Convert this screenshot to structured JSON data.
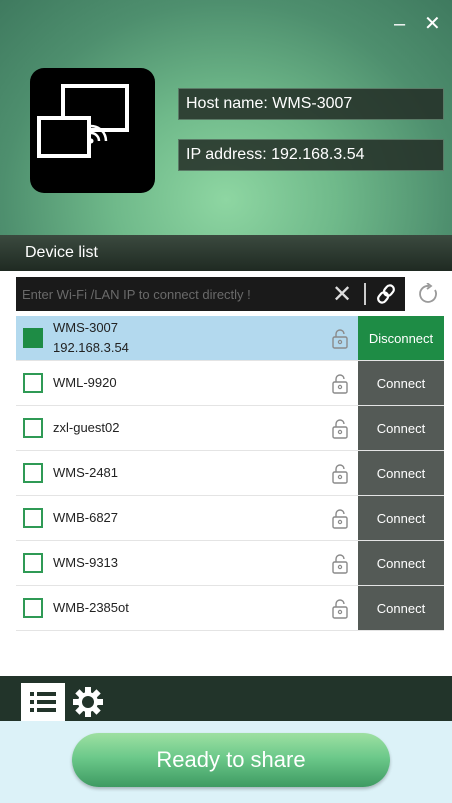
{
  "window": {
    "minimize_label": "–",
    "close_label": "✕"
  },
  "header": {
    "host_name": "Host name: WMS-3007",
    "ip_address": "IP address: 192.168.3.54"
  },
  "device_list_title": "Device list",
  "search": {
    "placeholder": "Enter Wi-Fi /LAN IP to connect directly !",
    "value": "",
    "clear_label": "✕"
  },
  "devices": [
    {
      "name": "WMS-3007",
      "ip": "192.168.3.54",
      "selected": true,
      "action": "Disconnect"
    },
    {
      "name": "WML-9920",
      "ip": "",
      "selected": false,
      "action": "Connect"
    },
    {
      "name": "zxl-guest02",
      "ip": "",
      "selected": false,
      "action": "Connect"
    },
    {
      "name": "WMS-2481",
      "ip": "",
      "selected": false,
      "action": "Connect"
    },
    {
      "name": "WMB-6827",
      "ip": "",
      "selected": false,
      "action": "Connect"
    },
    {
      "name": "WMS-9313",
      "ip": "",
      "selected": false,
      "action": "Connect"
    },
    {
      "name": "WMB-2385ot",
      "ip": "",
      "selected": false,
      "action": "Connect"
    }
  ],
  "share_button": "Ready to share",
  "icons": [
    "minimize-icon",
    "close-icon",
    "screen-mirror-icon",
    "clear-icon",
    "link-icon",
    "refresh-icon",
    "lock-icon",
    "list-icon",
    "gear-icon"
  ],
  "colors": {
    "accent_green": "#1e8c45",
    "selected_row": "#b3d9ee",
    "connect_button": "#545a56",
    "footer_bg": "#dcf2f8"
  }
}
